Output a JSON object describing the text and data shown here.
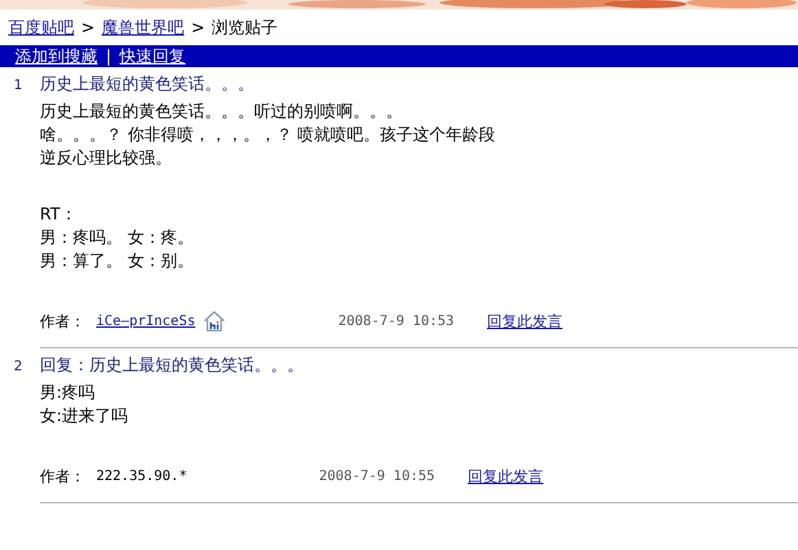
{
  "breadcrumb": [
    {
      "label": "百度贴吧",
      "kind": "link"
    },
    {
      "label": ">",
      "kind": "separator"
    },
    {
      "label": "魔兽世界吧",
      "kind": "link"
    },
    {
      "label": ">",
      "kind": "separator"
    },
    {
      "label": "浏览贴子",
      "kind": "text"
    }
  ],
  "toolbar": [
    {
      "label": "添加到搜藏",
      "kind": "link"
    },
    {
      "label": "|",
      "kind": "separator"
    },
    {
      "label": "快速回复",
      "kind": "link"
    }
  ],
  "posts": [
    {
      "number": "1",
      "title": "历史上最短的黄色笑话。。。",
      "paragraphs": [
        [
          "历史上最短的黄色笑话。。。听过的别喷啊。。。",
          "啥。。。？ 你非得喷，，，。，？ 喷就喷吧。孩子这个年龄段",
          "逆反心理比较强。"
        ],
        [
          "RT：",
          "男：疼吗。 女：疼。",
          "男：算了。 女：别。"
        ]
      ],
      "author_label": "作者：",
      "author": {
        "text": "iCe—prInceSs",
        "kind": "link"
      },
      "hi_icon": true,
      "time": "2008-7-9 10:53",
      "reply": "回复此发言"
    },
    {
      "number": "2",
      "title": "回复：历史上最短的黄色笑话。。。",
      "paragraphs": [
        [
          "男:疼吗",
          "女:进来了吗"
        ]
      ],
      "author_label": "作者：",
      "author": {
        "text": "222.35.90.*",
        "kind": "text"
      },
      "hi_icon": false,
      "time": "2008-7-9 10:55",
      "reply": "回复此发言"
    }
  ]
}
